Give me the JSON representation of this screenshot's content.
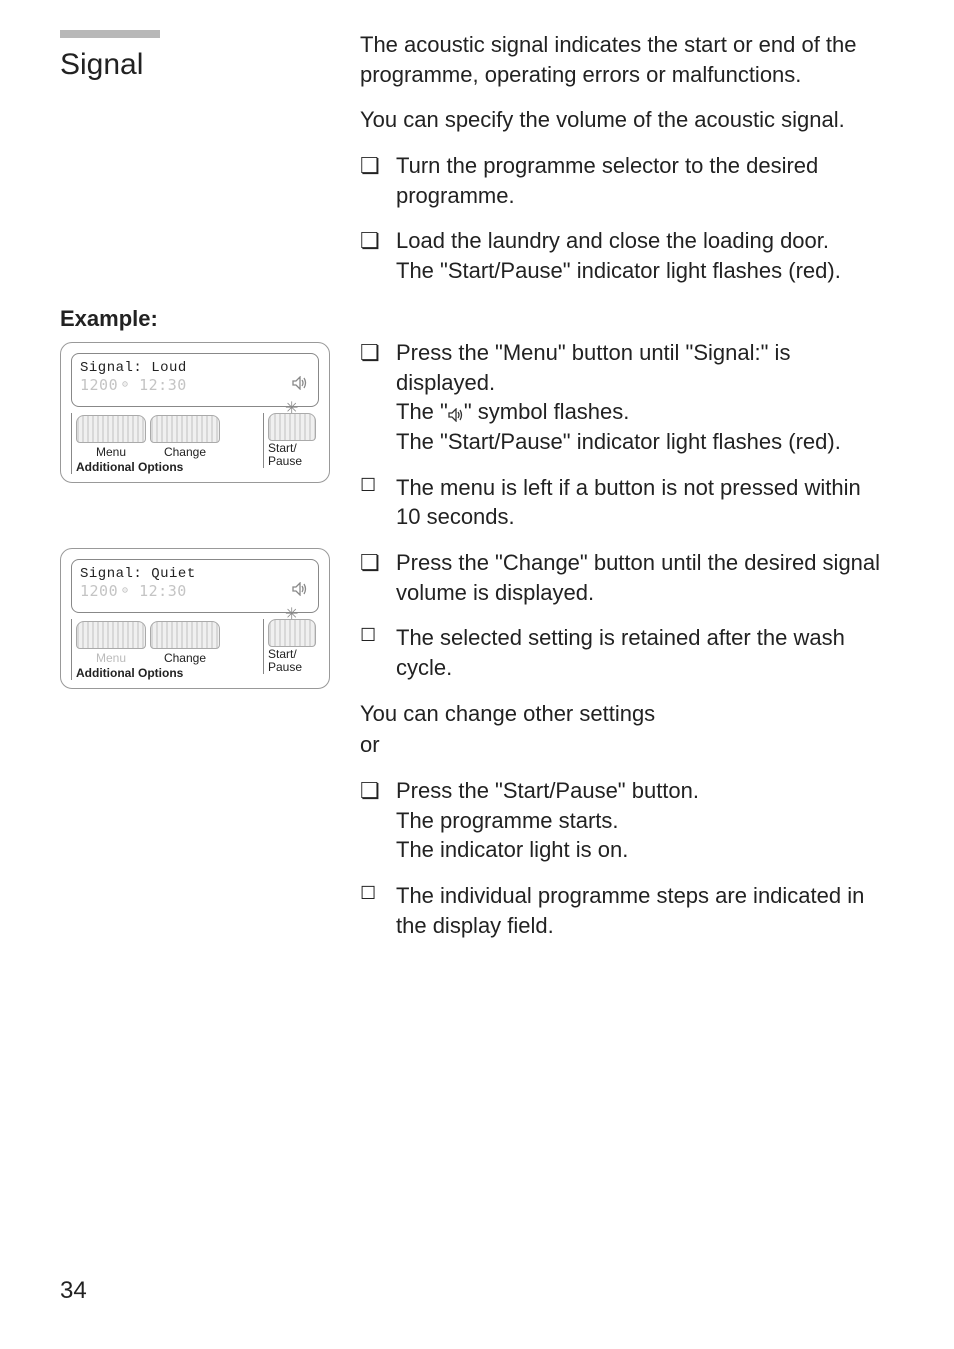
{
  "page_number": "34",
  "title": "Signal",
  "intro_p1": "The acoustic signal indicates the start or end of the programme, operating errors or malfunctions.",
  "intro_p2": "You can specify the volume of the acoustic signal.",
  "step1": "Turn the programme selector to the desired programme.",
  "step2a": "Load the laundry and close the loading door.",
  "step2b": "The \"Start/Pause\" indicator light flashes (red).",
  "example_label": "Example:",
  "step3a": "Press the \"Menu\" button until \"Signal:\" is displayed.",
  "step3b_pre": "The \"",
  "step3b_post": "\" symbol flashes.",
  "step3c": "The \"Start/Pause\" indicator light flashes (red).",
  "note1": "The menu is left if a button is not pressed within 10 seconds.",
  "step4": "Press the \"Change\" button until the desired signal volume is displayed.",
  "note2": "The selected setting is retained after the wash cycle.",
  "line_after": "You can change other settings",
  "or": "or",
  "step5a": "Press the \"Start/Pause\" button.",
  "step5b": "The programme starts.",
  "step5c": "The indicator light is on.",
  "note3": "The individual programme steps are indicated in the display field.",
  "panel1": {
    "lcd_line1": "Signal: Loud",
    "lcd_rpm": "1200",
    "lcd_time": "12:30",
    "menu": "Menu",
    "change": "Change",
    "addl": "Additional Options",
    "start": "Start/",
    "pause": "Pause"
  },
  "panel2": {
    "lcd_line1": "Signal: Quiet",
    "lcd_rpm": "1200",
    "lcd_time": "12:30",
    "menu": "Menu",
    "change": "Change",
    "addl": "Additional Options",
    "start": "Start/",
    "pause": "Pause"
  }
}
